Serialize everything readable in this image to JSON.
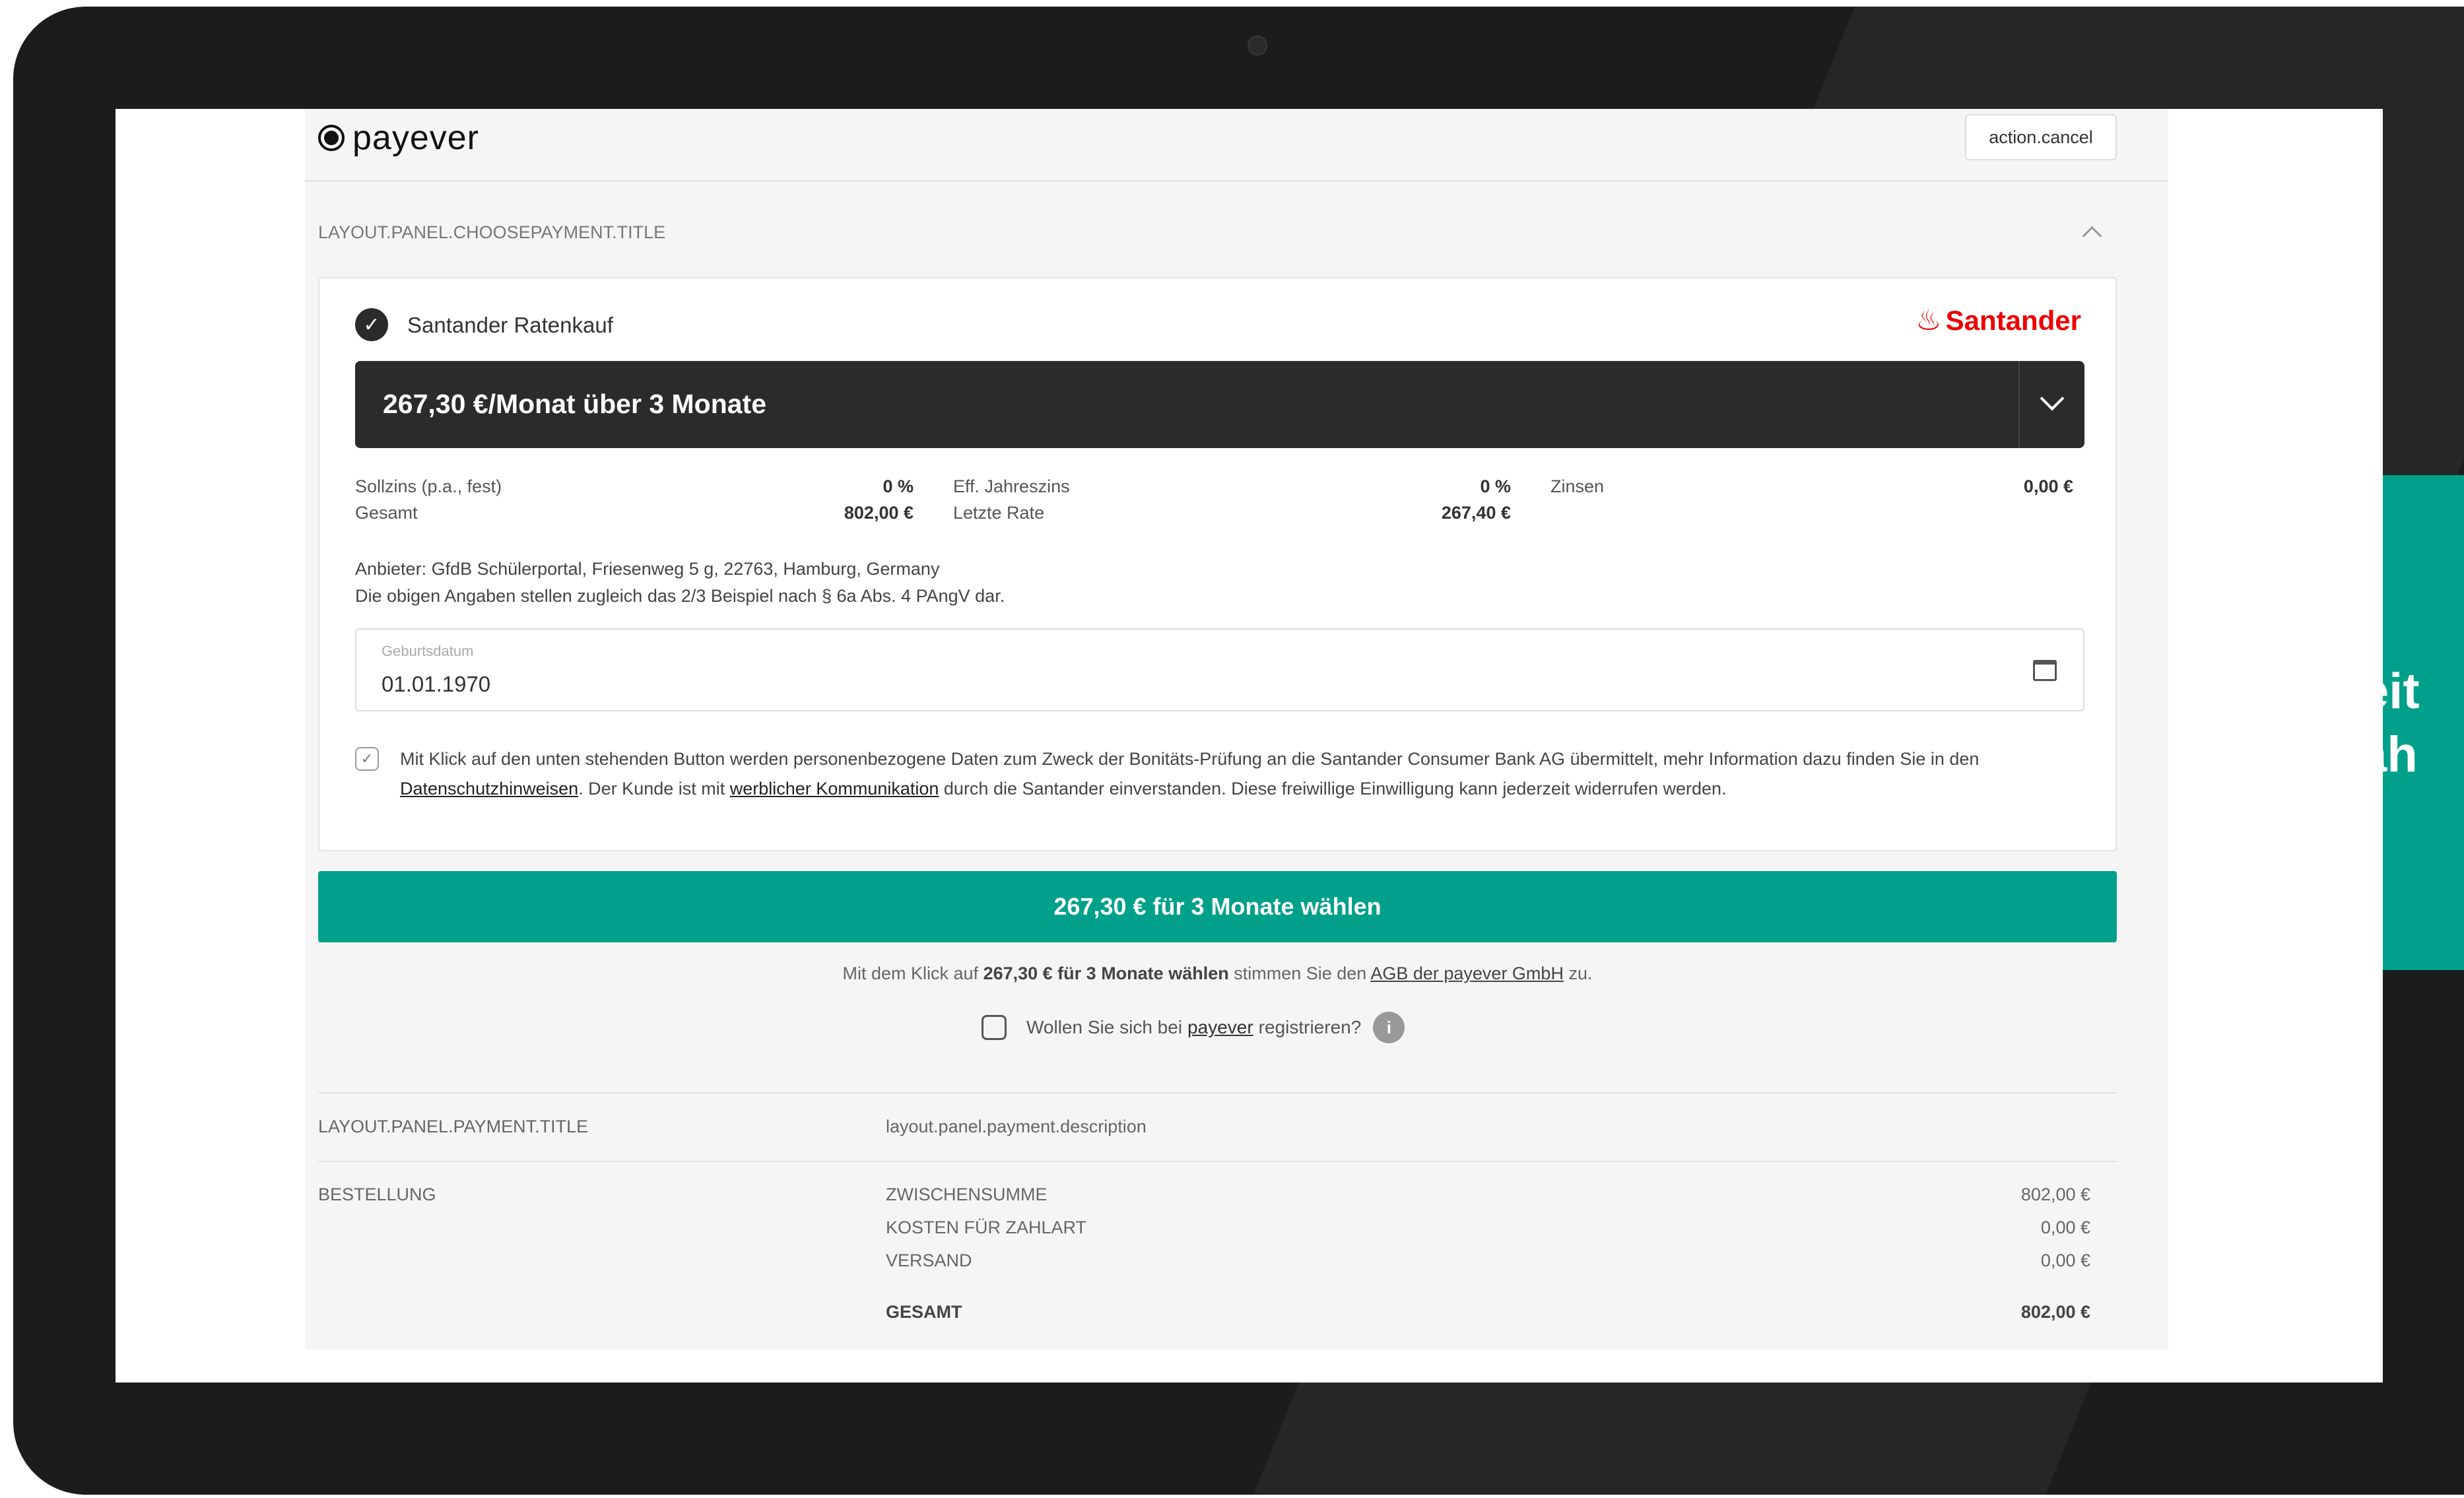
{
  "header": {
    "logo_text": "payever",
    "cancel_label": "action.cancel"
  },
  "choose_payment": {
    "title": "LAYOUT.PANEL.CHOOSEPAYMENT.TITLE"
  },
  "payment_option": {
    "name": "Santander Ratenkauf",
    "brand": "Santander",
    "rate_selected": "267,30 €/Monat über 3 Monate",
    "details": {
      "sollzins_label": "Sollzins (p.a., fest)",
      "sollzins_value": "0 %",
      "gesamt_label": "Gesamt",
      "gesamt_value": "802,00 €",
      "eff_label": "Eff. Jahreszins",
      "eff_value": "0 %",
      "letzte_label": "Letzte Rate",
      "letzte_value": "267,40 €",
      "zinsen_label": "Zinsen",
      "zinsen_value": "0,00 €"
    },
    "provider_line1": "Anbieter: GfdB Schülerportal, Friesenweg 5 g, 22763, Hamburg, Germany",
    "provider_line2": "Die obigen Angaben stellen zugleich das 2/3 Beispiel nach § 6a Abs. 4 PAngV dar.",
    "birthdate_label": "Geburtsdatum",
    "birthdate_value": "01.01.1970",
    "consent": {
      "text1": "Mit Klick auf den unten stehenden Button werden personenbezogene Daten zum Zweck der Bonitäts-Prüfung an die Santander Consumer Bank AG übermittelt, mehr Information dazu finden Sie in den ",
      "link1": "Datenschutzhinweisen",
      "text2": ". Der Kunde ist mit ",
      "link2": "werblicher Kommunikation",
      "text3": " durch die Santander einverstanden. Diese freiwillige Einwilligung kann jederzeit widerrufen werden."
    }
  },
  "cta": {
    "label": "267,30 € für 3 Monate wählen"
  },
  "agb": {
    "prefix": "Mit dem Klick auf ",
    "bold": "267,30 € für 3 Monate wählen",
    "middle": " stimmen Sie den ",
    "link": "AGB der payever GmbH",
    "suffix": " zu."
  },
  "register": {
    "prefix": "Wollen Sie sich bei",
    "link": "payever",
    "suffix": "registrieren?"
  },
  "payment_section": {
    "title": "LAYOUT.PANEL.PAYMENT.TITLE",
    "description": "layout.panel.payment.description"
  },
  "order": {
    "title": "BESTELLUNG",
    "rows": [
      {
        "label": "ZWISCHENSUMME",
        "value": "802,00 €"
      },
      {
        "label": "KOSTEN FÜR ZAHLART",
        "value": "0,00 €"
      },
      {
        "label": "VERSAND",
        "value": "0,00 €"
      }
    ],
    "total_label": "GESAMT",
    "total_value": "802,00 €"
  },
  "promo": {
    "line1": "Weiterleit",
    "line2": "Ratenzah"
  },
  "colors": {
    "accent": "#00a08a",
    "brand_red": "#ec0000",
    "dark": "#2b2b2b"
  }
}
